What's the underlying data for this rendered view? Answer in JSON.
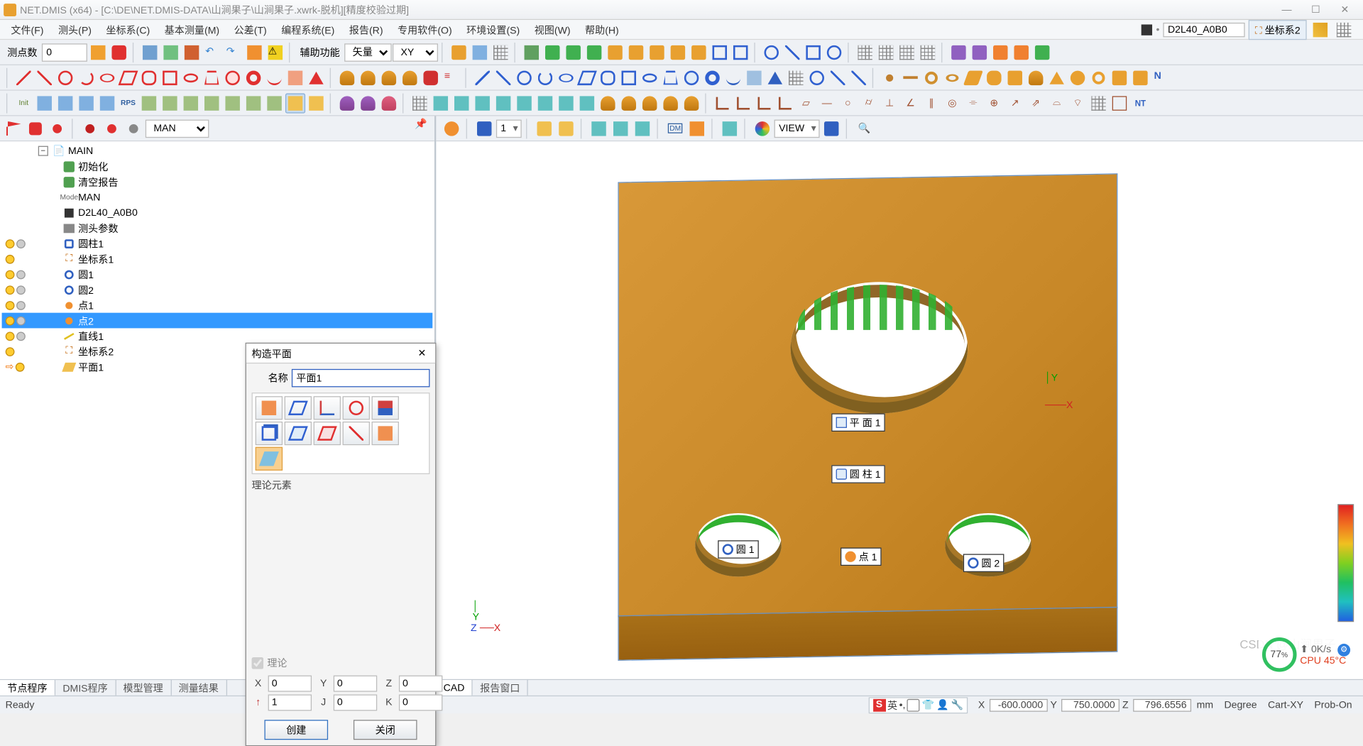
{
  "title": "NET.DMIS (x64) - [C:\\DE\\NET.DMIS-DATA\\山涧果子\\山涧果子.xwrk-脱机][精度校验过期]",
  "menus": [
    "文件(F)",
    "测头(P)",
    "坐标系(C)",
    "基本测量(M)",
    "公差(T)",
    "编程系统(E)",
    "报告(R)",
    "专用软件(O)",
    "环境设置(S)",
    "视图(W)",
    "帮助(H)"
  ],
  "probe_readout": "D2L40_A0B0",
  "cs_button": "坐标系2",
  "tb1": {
    "meas_pts_label": "测点数",
    "meas_pts_value": "0",
    "aux_label": "辅助功能",
    "aux_value": "矢量",
    "plane_value": "XY"
  },
  "left_tb": {
    "mode": "MAN"
  },
  "tree": {
    "root": "MAIN",
    "items": [
      {
        "icon": "init",
        "label": "初始化",
        "ind": 2
      },
      {
        "icon": "clear",
        "label": "清空报告",
        "ind": 2
      },
      {
        "icon": "mode",
        "label": "MAN",
        "ind": 2
      },
      {
        "icon": "probe",
        "label": "D2L40_A0B0",
        "ind": 2
      },
      {
        "icon": "param",
        "label": "测头参数",
        "ind": 2
      },
      {
        "icon": "cyl",
        "label": "圆柱1",
        "ind": 2,
        "bulb": true,
        "g": true
      },
      {
        "icon": "cs",
        "label": "坐标系1",
        "ind": 2,
        "bulb": true
      },
      {
        "icon": "circ",
        "label": "圆1",
        "ind": 2,
        "bulb": true,
        "g": true
      },
      {
        "icon": "circ",
        "label": "圆2",
        "ind": 2,
        "bulb": true,
        "g": true
      },
      {
        "icon": "pt",
        "label": "点1",
        "ind": 2,
        "bulb": true,
        "g": true
      },
      {
        "icon": "pt",
        "label": "点2",
        "ind": 2,
        "bulb": true,
        "g": true,
        "sel": true
      },
      {
        "icon": "line",
        "label": "直线1",
        "ind": 2,
        "bulb": true,
        "g": true
      },
      {
        "icon": "cs",
        "label": "坐标系2",
        "ind": 2,
        "bulb": true
      },
      {
        "icon": "plane",
        "label": "平面1",
        "ind": 2,
        "bulb": true,
        "arrow": true
      }
    ]
  },
  "dialog": {
    "title": "构造平面",
    "name_label": "名称",
    "name_value": "平面1",
    "section": "理论元素",
    "theory_chk": "理论",
    "coords": {
      "X": "0",
      "Y": "0",
      "Z": "0",
      "I": "1",
      "J": "0",
      "K": "0"
    },
    "create": "创建",
    "close": "关闭"
  },
  "right_tb": {
    "spin": "1",
    "view": "VIEW"
  },
  "viewport": {
    "labels": {
      "plane": "平 面 1",
      "cyl": "圆 柱 1",
      "circ1": "圆 1",
      "circ2": "圆 2",
      "pt1": "点 1"
    },
    "axes": {
      "x": "X",
      "y": "Y",
      "z": "Z"
    }
  },
  "cpu": {
    "pct": "77",
    "suffix": "%",
    "net": "0K/s",
    "temp": "CPU 45°C"
  },
  "watermark": "CSDN @山涧果子",
  "bottom_tabs_left": [
    "节点程序",
    "DMIS程序",
    "模型管理",
    "测量结果"
  ],
  "bottom_tabs_right": [
    "CAD",
    "报告窗口"
  ],
  "status": {
    "ready": "Ready",
    "ime": "英",
    "X": "-600.0000",
    "Y": "750.0000",
    "Z": "796.6556",
    "unit_len": "mm",
    "unit_ang": "Degree",
    "cart": "Cart-XY",
    "probe": "Prob-On"
  }
}
